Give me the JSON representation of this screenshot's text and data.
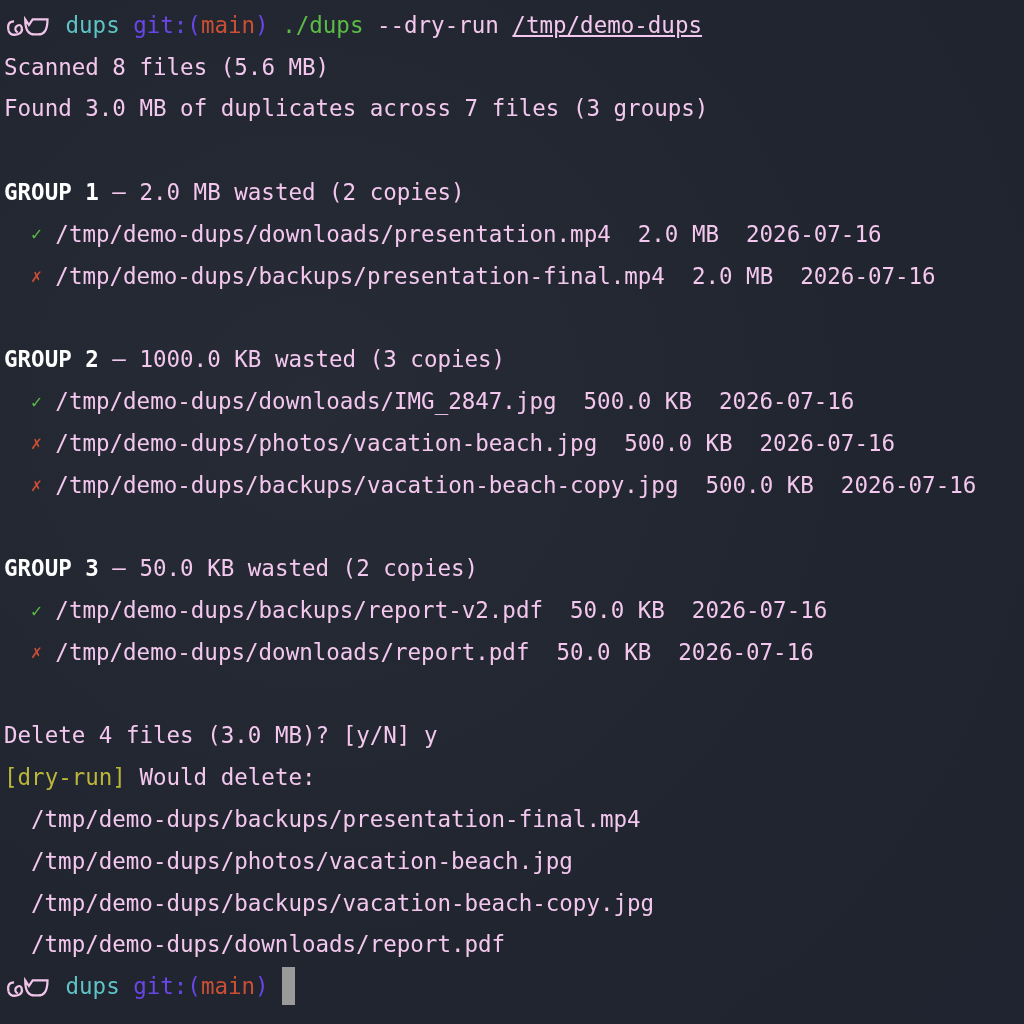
{
  "command_prompt": {
    "dir": "dups",
    "git_prefix": "git:(",
    "branch": "main",
    "git_suffix": ")",
    "command": "./dups",
    "option": "--dry-run",
    "path": "/tmp/demo-dups"
  },
  "summary": [
    "Scanned 8 files (5.6 MB)",
    "Found 3.0 MB of duplicates across 7 files (3 groups)"
  ],
  "groups": [
    {
      "label": "GROUP 1",
      "detail": "– 2.0 MB wasted (2 copies)",
      "files": [
        {
          "kept": true,
          "mark": "✓",
          "path": "/tmp/demo-dups/downloads/presentation.mp4",
          "size": "2.0 MB",
          "date": "2026-07-16"
        },
        {
          "kept": false,
          "mark": "✗",
          "path": "/tmp/demo-dups/backups/presentation-final.mp4",
          "size": "2.0 MB",
          "date": "2026-07-16"
        }
      ]
    },
    {
      "label": "GROUP 2",
      "detail": "– 1000.0 KB wasted (3 copies)",
      "files": [
        {
          "kept": true,
          "mark": "✓",
          "path": "/tmp/demo-dups/downloads/IMG_2847.jpg",
          "size": "500.0 KB",
          "date": "2026-07-16"
        },
        {
          "kept": false,
          "mark": "✗",
          "path": "/tmp/demo-dups/photos/vacation-beach.jpg",
          "size": "500.0 KB",
          "date": "2026-07-16"
        },
        {
          "kept": false,
          "mark": "✗",
          "path": "/tmp/demo-dups/backups/vacation-beach-copy.jpg",
          "size": "500.0 KB",
          "date": "2026-07-16"
        }
      ]
    },
    {
      "label": "GROUP 3",
      "detail": "– 50.0 KB wasted (2 copies)",
      "files": [
        {
          "kept": true,
          "mark": "✓",
          "path": "/tmp/demo-dups/backups/report-v2.pdf",
          "size": "50.0 KB",
          "date": "2026-07-16"
        },
        {
          "kept": false,
          "mark": "✗",
          "path": "/tmp/demo-dups/downloads/report.pdf",
          "size": "50.0 KB",
          "date": "2026-07-16"
        }
      ]
    }
  ],
  "confirm": "Delete 4 files (3.0 MB)? [y/N] y",
  "dry_run": {
    "tag": "[dry-run]",
    "message": "Would delete:"
  },
  "delete_list": [
    "/tmp/demo-dups/backups/presentation-final.mp4",
    "/tmp/demo-dups/photos/vacation-beach.jpg",
    "/tmp/demo-dups/backups/vacation-beach-copy.jpg",
    "/tmp/demo-dups/downloads/report.pdf"
  ],
  "final_prompt": {
    "dir": "dups",
    "git_prefix": "git:(",
    "branch": "main",
    "git_suffix": ")"
  }
}
